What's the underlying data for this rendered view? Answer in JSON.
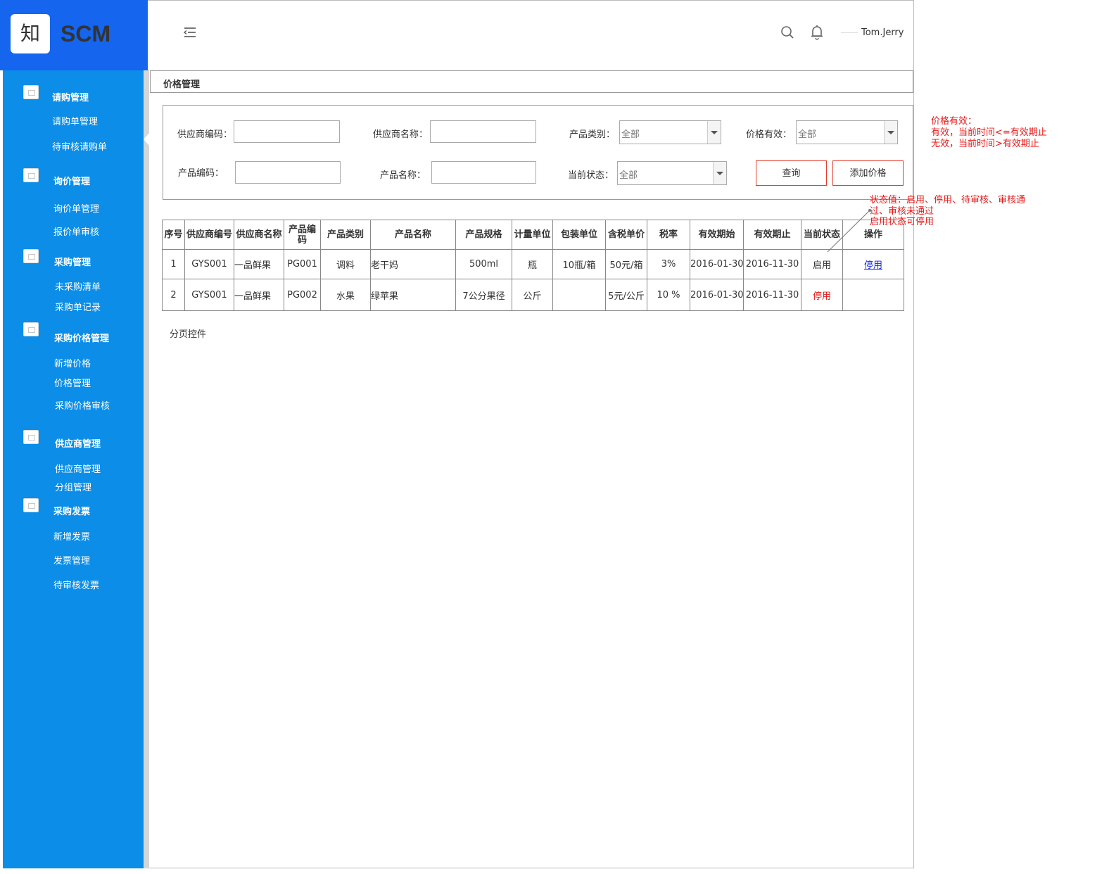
{
  "logo": {
    "glyph": "知",
    "text": "SCM"
  },
  "header": {
    "user_name": "Tom.Jerry"
  },
  "sidebar": {
    "groups": [
      {
        "label": "请购管理",
        "items": [
          "请购单管理",
          "待审核请购单"
        ]
      },
      {
        "label": "询价管理",
        "items": [
          "询价单管理",
          "报价单审核"
        ]
      },
      {
        "label": "采购管理",
        "items": [
          "未采购清单",
          "采购单记录"
        ]
      },
      {
        "label": "采购价格管理",
        "items": [
          "新增价格",
          "价格管理",
          "采购价格审核"
        ]
      },
      {
        "label": "供应商管理",
        "items": [
          "供应商管理",
          "分组管理"
        ]
      },
      {
        "label": "采购发票",
        "items": [
          "新增发票",
          "发票管理",
          "待审核发票"
        ]
      }
    ]
  },
  "page": {
    "title": "价格管理"
  },
  "filters": {
    "supplier_code_label": "供应商编码：",
    "supplier_name_label": "供应商名称：",
    "product_category_label": "产品类别：",
    "product_category_value": "全部",
    "price_valid_label": "价格有效：",
    "price_valid_value": "全部",
    "product_code_label": "产品编码：",
    "product_name_label": "产品名称：",
    "current_status_label": "当前状态：",
    "current_status_value": "全部",
    "query_button": "查询",
    "add_price_button": "添加价格"
  },
  "table": {
    "headers": [
      "序号",
      "供应商编号",
      "供应商名称",
      "产品编码",
      "产品类别",
      "产品名称",
      "产品规格",
      "计量单位",
      "包装单位",
      "含税单价",
      "税率",
      "有效期始",
      "有效期止",
      "当前状态",
      "操作"
    ],
    "rows": [
      [
        "1",
        "GYS001",
        "一品鲜果",
        "PG001",
        "调料",
        "老干妈",
        "500ml",
        "瓶",
        "10瓶/箱",
        "50元/箱",
        "3%",
        "2016-01-30",
        "2016-11-30",
        "启用",
        "停用"
      ],
      [
        "2",
        "GYS001",
        "一品鲜果",
        "PG002",
        "水果",
        "绿苹果",
        "7公分果径",
        "公斤",
        "",
        "5元/公斤",
        "10 %",
        "2016-01-30",
        "2016-11-30",
        "停用",
        ""
      ]
    ]
  },
  "pager": {
    "label": "分页控件"
  },
  "annotations": {
    "price_valid_title": "价格有效：",
    "price_valid_rule1": "有效，当前时间<=有效期止",
    "price_valid_rule2": "无效，当前时间>有效期止",
    "status_line1": "状态值：启用、停用、待审核、审核通",
    "status_line2": "过、审核未通过",
    "status_line3": "启用状态可停用"
  },
  "colors": {
    "logo_bg": "#1565ee",
    "sidebar_bg": "#0b8de8",
    "button_border": "#e53c2c",
    "annotation": "#e81818",
    "link": "#1020ee"
  }
}
